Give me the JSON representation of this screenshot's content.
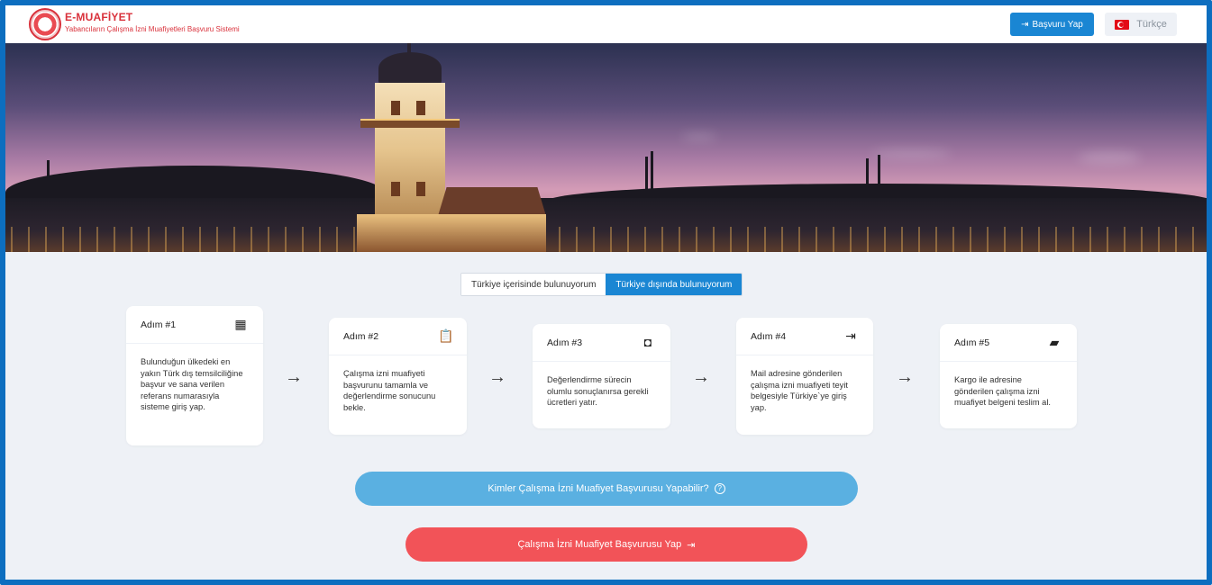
{
  "header": {
    "brand_title": "E-MUAFİYET",
    "brand_subtitle": "Yabancıların Çalışma İzni Muafiyetleri Başvuru Sistemi",
    "apply_button": "Başvuru Yap",
    "language": "Türkçe"
  },
  "location_toggle": {
    "options": [
      "Türkiye içerisinde bulunuyorum",
      "Türkiye dışında bulunuyorum"
    ],
    "selected": "Türkiye dışında bulunuyorum"
  },
  "steps": [
    {
      "title": "Adım #1",
      "icon": "building-icon",
      "text": "Bulunduğun ülkedeki en yakın Türk dış temsilciliğine başvur ve sana verilen referans numarasıyla sisteme giriş yap."
    },
    {
      "title": "Adım #2",
      "icon": "clipboard-icon",
      "text": "Çalışma izni muafiyeti başvurunu tamamla ve değerlendirme sonucunu bekle."
    },
    {
      "title": "Adım #3",
      "icon": "money-icon",
      "text": "Değerlendirme sürecin olumlu sonuçlanırsa gerekli ücretleri yatır."
    },
    {
      "title": "Adım #4",
      "icon": "door-enter-icon",
      "text": "Mail adresine gönderilen çalışma izni muafiyeti teyit belgesiyle Türkiye`ye giriş yap."
    },
    {
      "title": "Adım #5",
      "icon": "mailbox-icon",
      "text": "Kargo ile adresine gönderilen çalışma izni muafiyet belgeni teslim al."
    }
  ],
  "buttons": {
    "info": "Kimler Çalışma İzni Muafiyet Başvurusu Yapabilir?",
    "main": "Çalışma İzni Muafiyet Başvurusu Yap"
  },
  "colors": {
    "primary": "#1a86d3",
    "brand_red": "#d9313b",
    "info_button": "#5ab0e1",
    "main_button": "#f25358",
    "frame": "#0d6ebf"
  }
}
